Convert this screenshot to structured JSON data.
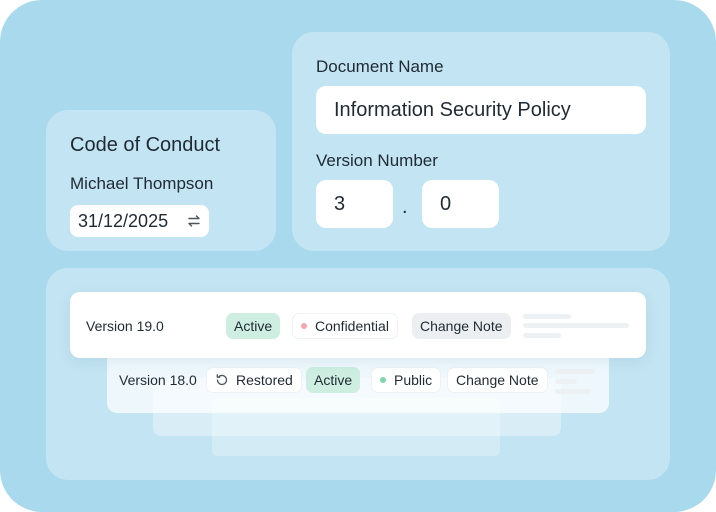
{
  "code_of_conduct": {
    "title": "Code of Conduct",
    "author": "Michael Thompson",
    "date": "31/12/2025",
    "date_icon": "swap-arrows-icon"
  },
  "document": {
    "name_label": "Document Name",
    "name_value": "Information Security Policy",
    "version_label": "Version Number",
    "version_major": "3",
    "version_separator": ".",
    "version_minor": "0"
  },
  "versions": [
    {
      "title": "Version 19.0",
      "status": "Active",
      "classification": "Confidential",
      "classification_color": "#f2a6ad",
      "note": "Change Note"
    },
    {
      "title": "Version 18.0",
      "restored_label": "Restored",
      "restored_icon": "restore-icon",
      "status": "Active",
      "classification": "Public",
      "classification_color": "#7fd6a8",
      "note": "Change Note"
    }
  ],
  "colors": {
    "background": "#a9d9ec",
    "active_badge": "#cdeee0"
  }
}
